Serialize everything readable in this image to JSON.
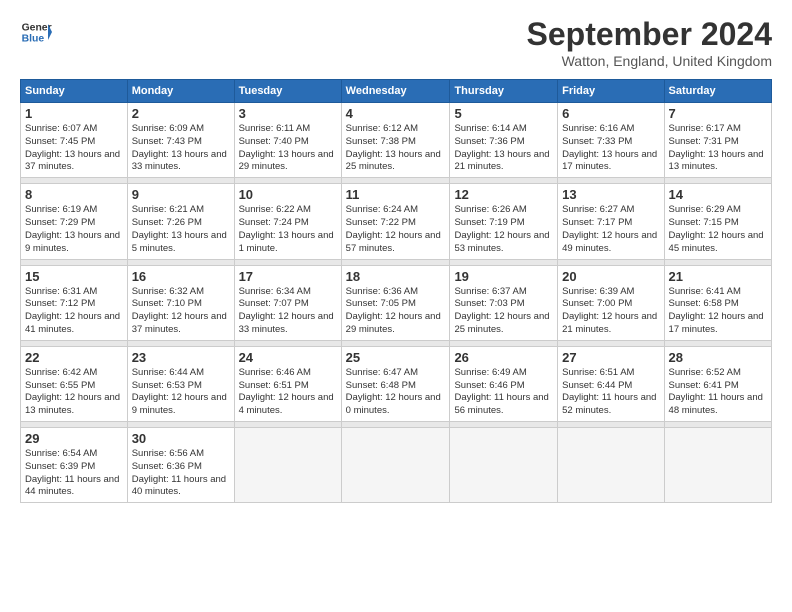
{
  "header": {
    "logo_text_line1": "General",
    "logo_text_line2": "Blue",
    "month": "September 2024",
    "location": "Watton, England, United Kingdom"
  },
  "days_of_week": [
    "Sunday",
    "Monday",
    "Tuesday",
    "Wednesday",
    "Thursday",
    "Friday",
    "Saturday"
  ],
  "weeks": [
    [
      {
        "day": "1",
        "info": "Sunrise: 6:07 AM\nSunset: 7:45 PM\nDaylight: 13 hours and 37 minutes."
      },
      {
        "day": "2",
        "info": "Sunrise: 6:09 AM\nSunset: 7:43 PM\nDaylight: 13 hours and 33 minutes."
      },
      {
        "day": "3",
        "info": "Sunrise: 6:11 AM\nSunset: 7:40 PM\nDaylight: 13 hours and 29 minutes."
      },
      {
        "day": "4",
        "info": "Sunrise: 6:12 AM\nSunset: 7:38 PM\nDaylight: 13 hours and 25 minutes."
      },
      {
        "day": "5",
        "info": "Sunrise: 6:14 AM\nSunset: 7:36 PM\nDaylight: 13 hours and 21 minutes."
      },
      {
        "day": "6",
        "info": "Sunrise: 6:16 AM\nSunset: 7:33 PM\nDaylight: 13 hours and 17 minutes."
      },
      {
        "day": "7",
        "info": "Sunrise: 6:17 AM\nSunset: 7:31 PM\nDaylight: 13 hours and 13 minutes."
      }
    ],
    [
      {
        "day": "8",
        "info": "Sunrise: 6:19 AM\nSunset: 7:29 PM\nDaylight: 13 hours and 9 minutes."
      },
      {
        "day": "9",
        "info": "Sunrise: 6:21 AM\nSunset: 7:26 PM\nDaylight: 13 hours and 5 minutes."
      },
      {
        "day": "10",
        "info": "Sunrise: 6:22 AM\nSunset: 7:24 PM\nDaylight: 13 hours and 1 minute."
      },
      {
        "day": "11",
        "info": "Sunrise: 6:24 AM\nSunset: 7:22 PM\nDaylight: 12 hours and 57 minutes."
      },
      {
        "day": "12",
        "info": "Sunrise: 6:26 AM\nSunset: 7:19 PM\nDaylight: 12 hours and 53 minutes."
      },
      {
        "day": "13",
        "info": "Sunrise: 6:27 AM\nSunset: 7:17 PM\nDaylight: 12 hours and 49 minutes."
      },
      {
        "day": "14",
        "info": "Sunrise: 6:29 AM\nSunset: 7:15 PM\nDaylight: 12 hours and 45 minutes."
      }
    ],
    [
      {
        "day": "15",
        "info": "Sunrise: 6:31 AM\nSunset: 7:12 PM\nDaylight: 12 hours and 41 minutes."
      },
      {
        "day": "16",
        "info": "Sunrise: 6:32 AM\nSunset: 7:10 PM\nDaylight: 12 hours and 37 minutes."
      },
      {
        "day": "17",
        "info": "Sunrise: 6:34 AM\nSunset: 7:07 PM\nDaylight: 12 hours and 33 minutes."
      },
      {
        "day": "18",
        "info": "Sunrise: 6:36 AM\nSunset: 7:05 PM\nDaylight: 12 hours and 29 minutes."
      },
      {
        "day": "19",
        "info": "Sunrise: 6:37 AM\nSunset: 7:03 PM\nDaylight: 12 hours and 25 minutes."
      },
      {
        "day": "20",
        "info": "Sunrise: 6:39 AM\nSunset: 7:00 PM\nDaylight: 12 hours and 21 minutes."
      },
      {
        "day": "21",
        "info": "Sunrise: 6:41 AM\nSunset: 6:58 PM\nDaylight: 12 hours and 17 minutes."
      }
    ],
    [
      {
        "day": "22",
        "info": "Sunrise: 6:42 AM\nSunset: 6:55 PM\nDaylight: 12 hours and 13 minutes."
      },
      {
        "day": "23",
        "info": "Sunrise: 6:44 AM\nSunset: 6:53 PM\nDaylight: 12 hours and 9 minutes."
      },
      {
        "day": "24",
        "info": "Sunrise: 6:46 AM\nSunset: 6:51 PM\nDaylight: 12 hours and 4 minutes."
      },
      {
        "day": "25",
        "info": "Sunrise: 6:47 AM\nSunset: 6:48 PM\nDaylight: 12 hours and 0 minutes."
      },
      {
        "day": "26",
        "info": "Sunrise: 6:49 AM\nSunset: 6:46 PM\nDaylight: 11 hours and 56 minutes."
      },
      {
        "day": "27",
        "info": "Sunrise: 6:51 AM\nSunset: 6:44 PM\nDaylight: 11 hours and 52 minutes."
      },
      {
        "day": "28",
        "info": "Sunrise: 6:52 AM\nSunset: 6:41 PM\nDaylight: 11 hours and 48 minutes."
      }
    ],
    [
      {
        "day": "29",
        "info": "Sunrise: 6:54 AM\nSunset: 6:39 PM\nDaylight: 11 hours and 44 minutes."
      },
      {
        "day": "30",
        "info": "Sunrise: 6:56 AM\nSunset: 6:36 PM\nDaylight: 11 hours and 40 minutes."
      },
      {
        "day": "",
        "info": ""
      },
      {
        "day": "",
        "info": ""
      },
      {
        "day": "",
        "info": ""
      },
      {
        "day": "",
        "info": ""
      },
      {
        "day": "",
        "info": ""
      }
    ]
  ]
}
